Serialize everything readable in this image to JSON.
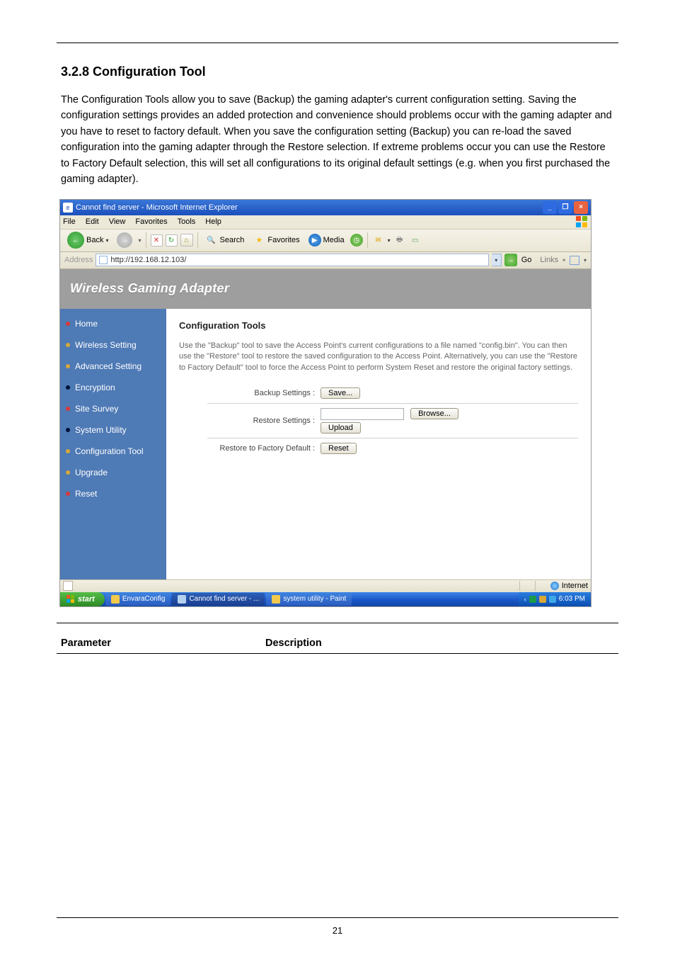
{
  "doc": {
    "section_heading": "3.2.8 Configuration Tool",
    "paragraph": "The Configuration Tools allow you to save (Backup) the gaming adapter's current configuration setting. Saving the configuration settings provides an added protection and convenience should problems occur with the gaming adapter and you have to reset to factory default. When you save the configuration setting (Backup) you can re-load the saved configuration into the gaming adapter through the Restore selection. If extreme problems occur you can use the Restore to Factory Default selection, this will set all configurations to its original default settings (e.g. when you first purchased the gaming adapter).",
    "footer_label": "Parameter",
    "footer_desc": "Description",
    "page_number": "21"
  },
  "ie": {
    "title": "Cannot find server - Microsoft Internet Explorer",
    "menu": {
      "file": "File",
      "edit": "Edit",
      "view": "View",
      "favorites": "Favorites",
      "tools": "Tools",
      "help": "Help"
    },
    "toolbar": {
      "back": "Back",
      "search": "Search",
      "favorites": "Favorites",
      "media": "Media"
    },
    "address_label": "Address",
    "address_value": "http://192.168.12.103/",
    "go_label": "Go",
    "links_label": "Links",
    "status": {
      "left_icon_present": true,
      "right_text": "Internet"
    }
  },
  "app": {
    "banner_title": "Wireless Gaming Adapter",
    "nav": [
      {
        "label": "Home",
        "bullet": "b-red"
      },
      {
        "label": "Wireless Setting",
        "bullet": "b-yellow"
      },
      {
        "label": "Advanced Setting",
        "bullet": "b-yellow"
      },
      {
        "label": "Encryption",
        "bullet": "b-blue"
      },
      {
        "label": "Site Survey",
        "bullet": "b-red"
      },
      {
        "label": "System Utility",
        "bullet": "b-blue"
      },
      {
        "label": "Configuration Tool",
        "bullet": "b-yellow"
      },
      {
        "label": "Upgrade",
        "bullet": "b-yellow"
      },
      {
        "label": "Reset",
        "bullet": "b-red"
      }
    ],
    "content": {
      "heading": "Configuration Tools",
      "description": "Use the \"Backup\" tool to save the Access Point's current configurations to a file named \"config.bin\". You can then use the \"Restore\" tool to restore the saved configuration to the Access Point. Alternatively, you can use the \"Restore to Factory Default\" tool to force the Access Point to perform System Reset and restore the original factory settings.",
      "row1_label": "Backup Settings :",
      "row1_btn": "Save...",
      "row2_label": "Restore Settings :",
      "row2_input": "",
      "row2_browse": "Browse...",
      "row2_upload": "Upload",
      "row3_label": "Restore to Factory Default :",
      "row3_btn": "Reset"
    }
  },
  "taskbar": {
    "start": "start",
    "items": [
      {
        "label": "EnvaraConfig",
        "icon": "folder"
      },
      {
        "label": "Cannot find server - ...",
        "icon": "ie"
      },
      {
        "label": "system utility - Paint",
        "icon": "paint"
      }
    ],
    "time": "6:03 PM"
  }
}
